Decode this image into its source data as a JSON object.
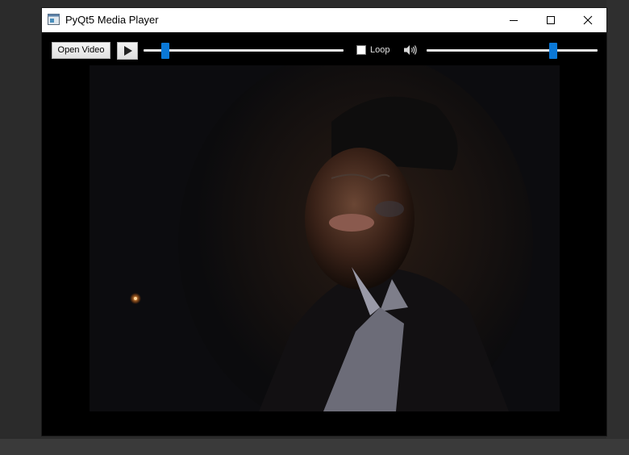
{
  "window": {
    "title": "PyQt5 Media Player",
    "title_icon": "app-window-icon",
    "controls": [
      "minimize-icon",
      "maximize-icon",
      "close-icon"
    ]
  },
  "toolbar": {
    "open_label": "Open Video",
    "play_icon": "play-icon",
    "position_fraction": 0.11,
    "loop_label": "Loop",
    "loop_checked": false,
    "volume_icon": "speaker-icon",
    "volume_fraction": 0.74,
    "accent_color": "#0a78d7"
  },
  "video": {
    "description_icon": "video-frame"
  }
}
